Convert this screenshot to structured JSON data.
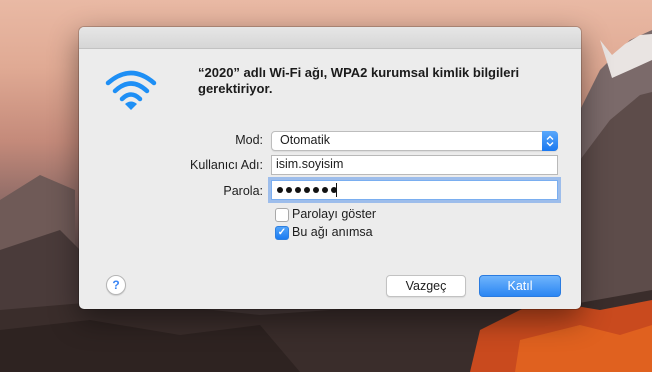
{
  "dialog": {
    "message": "“2020” adlı Wi-Fi ağı, WPA2 kurumsal kimlik bilgileri gerektiriyor.",
    "mode_label": "Mod:",
    "mode_value": "Otomatik",
    "username_label": "Kullanıcı Adı:",
    "username_value": "isim.soyisim",
    "password_label": "Parola:",
    "password_length": 7,
    "show_password_label": "Parolayı göster",
    "show_password_checked": false,
    "remember_label": "Bu ağı anımsa",
    "remember_checked": true,
    "help_label": "?",
    "cancel_label": "Vazgeç",
    "join_label": "Katıl"
  },
  "icons": {
    "network": "wifi-icon",
    "stepper": "chevron-up-down-icon",
    "check": "checkmark-icon"
  },
  "colors": {
    "accent": "#1a78f0",
    "wifi": "#1e8ff5"
  }
}
